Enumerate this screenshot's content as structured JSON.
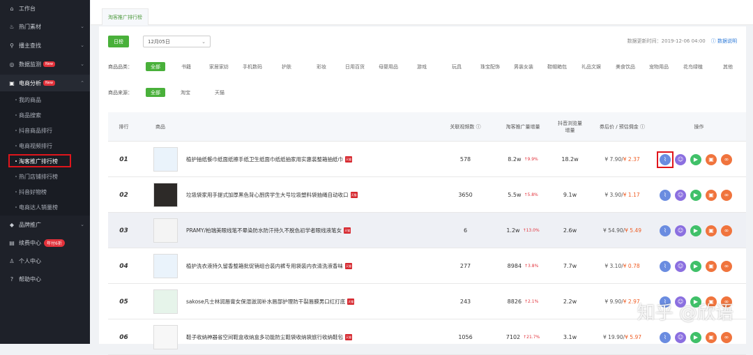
{
  "sidebar": {
    "items": [
      {
        "label": "工作台",
        "icon": "home-icon"
      },
      {
        "label": "热门素材",
        "icon": "fire-icon",
        "arrow": "⌄"
      },
      {
        "label": "播主查找",
        "icon": "search-icon",
        "arrow": "⌄"
      },
      {
        "label": "数据监测",
        "icon": "monitor-icon",
        "badge": "New",
        "arrow": "⌄"
      },
      {
        "label": "电商分析",
        "icon": "shop-icon",
        "badge": "New",
        "arrow": "⌃"
      }
    ],
    "sub_items": [
      "我的商品",
      "商品搜索",
      "抖音商品排行",
      "电商视频排行",
      "淘客推广排行榜",
      "热门店铺排行榜",
      "抖音好物榜",
      "电商达人销量榜"
    ],
    "bottom_items": [
      {
        "label": "品牌推广",
        "icon": "diamond-icon",
        "arrow": "⌄"
      },
      {
        "label": "续费中心",
        "icon": "card-icon",
        "badge": "年付6折"
      },
      {
        "label": "个人中心",
        "icon": "user-icon"
      },
      {
        "label": "帮助中心",
        "icon": "help-icon"
      }
    ]
  },
  "tab": {
    "label": "淘客推广排行榜"
  },
  "toolbar": {
    "day_label": "日榜",
    "date_value": "12月05日",
    "updated_text": "数据更新时间：2019-12-06 04:00",
    "help_text": "数据说明"
  },
  "filters": {
    "category_label": "商品品类：",
    "categories": [
      "全部",
      "书籍",
      "家居家纺",
      "手机数码",
      "护肤",
      "彩妆",
      "日用百货",
      "母婴用品",
      "游戏",
      "玩具",
      "珠宝配饰",
      "男装女装",
      "鞋帽箱包",
      "礼品文娱",
      "美食饮品",
      "宠物用品",
      "花鸟绿植",
      "其他"
    ],
    "source_label": "商品来源：",
    "sources": [
      "全部",
      "淘宝",
      "天猫"
    ]
  },
  "table": {
    "headers": {
      "rank": "排行",
      "product": "商品",
      "videos": "关联视频数 ⓘ",
      "promo": "淘客推广量增量",
      "views": "抖音浏览量增量",
      "price": "券后价 / 预估佣金 ⓘ",
      "ops": "操作"
    },
    "rows": [
      {
        "rank": "01",
        "name": "植护抽纸餐巾纸面纸擦手纸卫生纸面巾纸纸抽家用实惠装整箱抽纸巾",
        "videos": "578",
        "promo": "8.2w",
        "promo_up": "↑9.9%",
        "views": "18.2w",
        "price": "¥ 7.90/",
        "commission": "¥ 2.37"
      },
      {
        "rank": "02",
        "name": "垃圾袋家用手提式加厚黑色背心厨房学生大号垃圾塑料袋抽绳自动收口",
        "videos": "3650",
        "promo": "5.5w",
        "promo_up": "↑5.8%",
        "views": "9.1w",
        "price": "¥ 3.90/",
        "commission": "¥ 1.17"
      },
      {
        "rank": "03",
        "name": "PRAMY/柏瑞美眼线笔不晕染防水防汗持久不脱色初学者眼线液笔女",
        "videos": "6",
        "promo": "1.2w",
        "promo_up": "↑13.0%",
        "views": "2.6w",
        "price": "¥ 54.90/",
        "commission": "¥ 5.49"
      },
      {
        "rank": "04",
        "name": "植护洗衣液持久留香整箱批促销组合装内裤专用袋装内衣清洗液香味",
        "videos": "277",
        "promo": "8984",
        "promo_up": "↑3.8%",
        "views": "7.7w",
        "price": "¥ 3.10/",
        "commission": "¥ 0.78"
      },
      {
        "rank": "05",
        "name": "sakose凡士林润唇膏女保湿滋润补水唇部护理防干裂唇膜男口红打底",
        "videos": "243",
        "promo": "8826",
        "promo_up": "↑2.1%",
        "views": "2.2w",
        "price": "¥ 9.90/",
        "commission": "¥ 2.97"
      },
      {
        "rank": "06",
        "name": "鞋子收纳神器省空间鞋盒收纳盒多功能防尘鞋袋收纳袋旅行收纳鞋包",
        "videos": "1056",
        "promo": "7102",
        "promo_up": "↑21.7%",
        "views": "3.1w",
        "price": "¥ 19.90/",
        "commission": "¥ 5.97"
      }
    ],
    "tm_label": "天猫"
  },
  "watermark": "知乎 @欣语"
}
